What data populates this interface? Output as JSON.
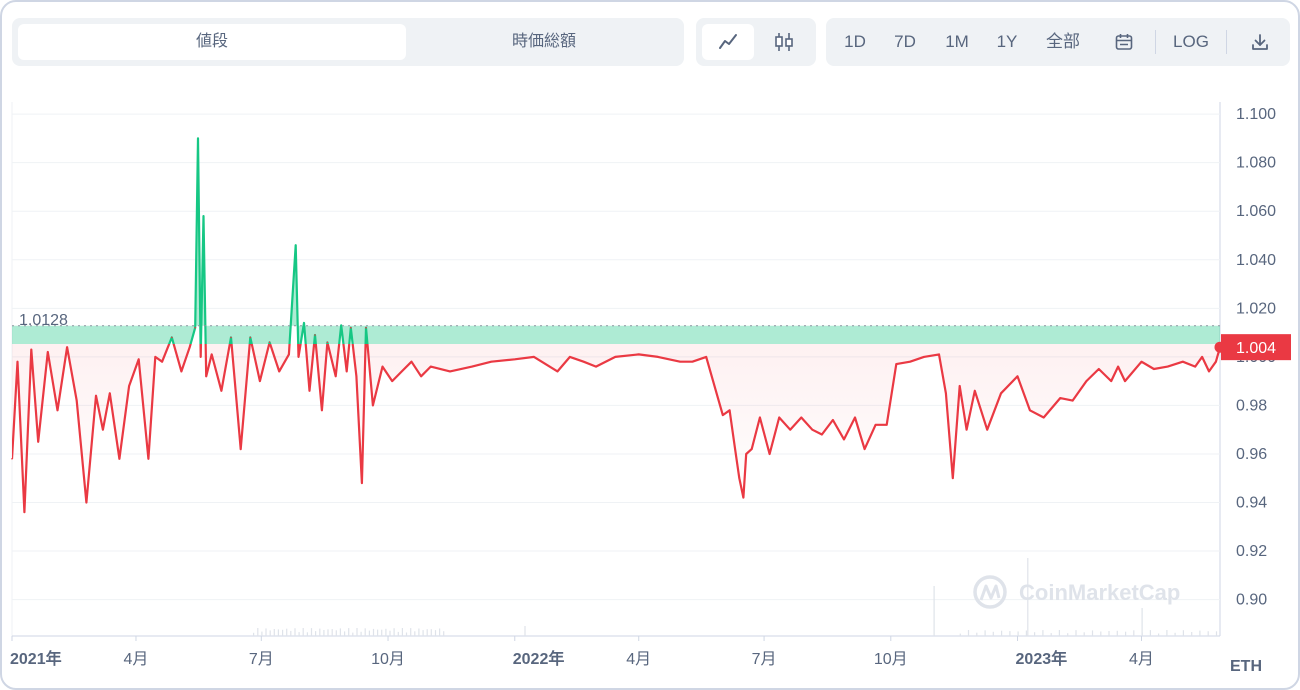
{
  "tabs": [
    {
      "label": "値段"
    },
    {
      "label": "時価総額"
    }
  ],
  "view_buttons": [
    {
      "icon": "line-chart-icon"
    },
    {
      "icon": "candlestick-icon"
    }
  ],
  "range_buttons": [
    {
      "label": "1D"
    },
    {
      "label": "7D"
    },
    {
      "label": "1M"
    },
    {
      "label": "1Y"
    },
    {
      "label": "全部"
    }
  ],
  "calendar_icon": "calendar-icon",
  "log_label": "LOG",
  "download_icon": "download-icon",
  "unit_label": "ETH",
  "watermark": "CoinMarketCap",
  "colors": {
    "up": "#16c784",
    "down": "#ea3943",
    "grid": "#eff2f5",
    "text": "#58667e"
  },
  "chart_data": {
    "type": "line",
    "title": "",
    "xlabel": "",
    "ylabel": "",
    "ylim": [
      0.885,
      1.105
    ],
    "xlim": [
      "2021-01-01",
      "2023-05-28"
    ],
    "y_ticks": [
      "1.100",
      "1.080",
      "1.060",
      "1.040",
      "1.020",
      "1.000",
      "0.98",
      "0.96",
      "0.94",
      "0.92",
      "0.90"
    ],
    "x_ticks": [
      {
        "label": "2021年",
        "date": "2021-01-01",
        "bold": true
      },
      {
        "label": "4月",
        "date": "2021-04-01"
      },
      {
        "label": "7月",
        "date": "2021-07-01"
      },
      {
        "label": "10月",
        "date": "2021-10-01"
      },
      {
        "label": "2022年",
        "date": "2022-01-01",
        "bold": true
      },
      {
        "label": "4月",
        "date": "2022-04-01"
      },
      {
        "label": "7月",
        "date": "2022-07-01"
      },
      {
        "label": "10月",
        "date": "2022-10-01"
      },
      {
        "label": "2023年",
        "date": "2023-01-01",
        "bold": true
      },
      {
        "label": "4月",
        "date": "2023-04-01"
      }
    ],
    "baseline": {
      "value": 1.0128,
      "label": "1.0128"
    },
    "current": {
      "value": 1.004,
      "label": "1.004"
    },
    "series": [
      {
        "x": [
          "2021-01-01",
          "2021-01-05",
          "2021-01-10",
          "2021-01-15",
          "2021-01-20",
          "2021-01-27",
          "2021-02-03",
          "2021-02-10",
          "2021-02-17",
          "2021-02-24",
          "2021-03-03",
          "2021-03-08",
          "2021-03-13",
          "2021-03-20",
          "2021-03-27",
          "2021-04-03",
          "2021-04-10",
          "2021-04-15",
          "2021-04-20",
          "2021-04-27",
          "2021-05-04",
          "2021-05-10",
          "2021-05-14",
          "2021-05-16",
          "2021-05-18",
          "2021-05-20",
          "2021-05-22",
          "2021-05-26",
          "2021-06-02",
          "2021-06-09",
          "2021-06-16",
          "2021-06-23",
          "2021-06-30",
          "2021-07-07",
          "2021-07-14",
          "2021-07-21",
          "2021-07-26",
          "2021-07-28",
          "2021-08-01",
          "2021-08-05",
          "2021-08-09",
          "2021-08-14",
          "2021-08-18",
          "2021-08-24",
          "2021-08-28",
          "2021-09-01",
          "2021-09-04",
          "2021-09-08",
          "2021-09-12",
          "2021-09-15",
          "2021-09-20",
          "2021-09-27",
          "2021-10-04",
          "2021-10-11",
          "2021-10-18",
          "2021-10-25",
          "2021-11-01",
          "2021-11-15",
          "2021-12-01",
          "2021-12-15",
          "2022-01-01",
          "2022-01-15",
          "2022-02-01",
          "2022-02-10",
          "2022-02-20",
          "2022-03-01",
          "2022-03-15",
          "2022-04-01",
          "2022-04-15",
          "2022-05-01",
          "2022-05-10",
          "2022-05-20",
          "2022-06-01",
          "2022-06-06",
          "2022-06-10",
          "2022-06-13",
          "2022-06-16",
          "2022-06-18",
          "2022-06-22",
          "2022-06-28",
          "2022-07-05",
          "2022-07-12",
          "2022-07-20",
          "2022-07-28",
          "2022-08-05",
          "2022-08-12",
          "2022-08-20",
          "2022-08-28",
          "2022-09-05",
          "2022-09-12",
          "2022-09-20",
          "2022-09-28",
          "2022-10-05",
          "2022-10-15",
          "2022-10-25",
          "2022-11-05",
          "2022-11-10",
          "2022-11-15",
          "2022-11-20",
          "2022-11-25",
          "2022-12-01",
          "2022-12-10",
          "2022-12-20",
          "2023-01-01",
          "2023-01-10",
          "2023-01-20",
          "2023-02-01",
          "2023-02-10",
          "2023-02-20",
          "2023-03-01",
          "2023-03-10",
          "2023-03-15",
          "2023-03-20",
          "2023-04-01",
          "2023-04-10",
          "2023-04-20",
          "2023-05-01",
          "2023-05-10",
          "2023-05-15",
          "2023-05-20",
          "2023-05-25",
          "2023-05-28"
        ],
        "y": [
          0.958,
          0.998,
          0.936,
          1.003,
          0.965,
          1.002,
          0.978,
          1.004,
          0.982,
          0.94,
          0.984,
          0.97,
          0.985,
          0.958,
          0.988,
          0.999,
          0.958,
          1.0,
          0.998,
          1.008,
          0.994,
          1.004,
          1.012,
          1.09,
          1.0,
          1.058,
          0.992,
          1.001,
          0.986,
          1.008,
          0.962,
          1.008,
          0.99,
          1.006,
          0.994,
          1.001,
          1.046,
          1.0,
          1.014,
          0.986,
          1.009,
          0.978,
          1.006,
          0.992,
          1.013,
          0.994,
          1.012,
          0.992,
          0.948,
          1.012,
          0.98,
          0.996,
          0.99,
          0.994,
          0.998,
          0.992,
          0.996,
          0.994,
          0.996,
          0.998,
          0.999,
          1.0,
          0.994,
          1.0,
          0.998,
          0.996,
          1.0,
          1.001,
          1.0,
          0.998,
          0.998,
          1.0,
          0.976,
          0.978,
          0.962,
          0.95,
          0.942,
          0.96,
          0.962,
          0.975,
          0.96,
          0.975,
          0.97,
          0.975,
          0.97,
          0.968,
          0.974,
          0.966,
          0.975,
          0.962,
          0.972,
          0.972,
          0.997,
          0.998,
          1.0,
          1.001,
          0.985,
          0.95,
          0.988,
          0.97,
          0.986,
          0.97,
          0.985,
          0.992,
          0.978,
          0.975,
          0.983,
          0.982,
          0.99,
          0.995,
          0.99,
          0.996,
          0.99,
          0.998,
          0.995,
          0.996,
          0.998,
          0.996,
          1.0,
          0.994,
          0.998,
          1.004
        ]
      }
    ]
  }
}
